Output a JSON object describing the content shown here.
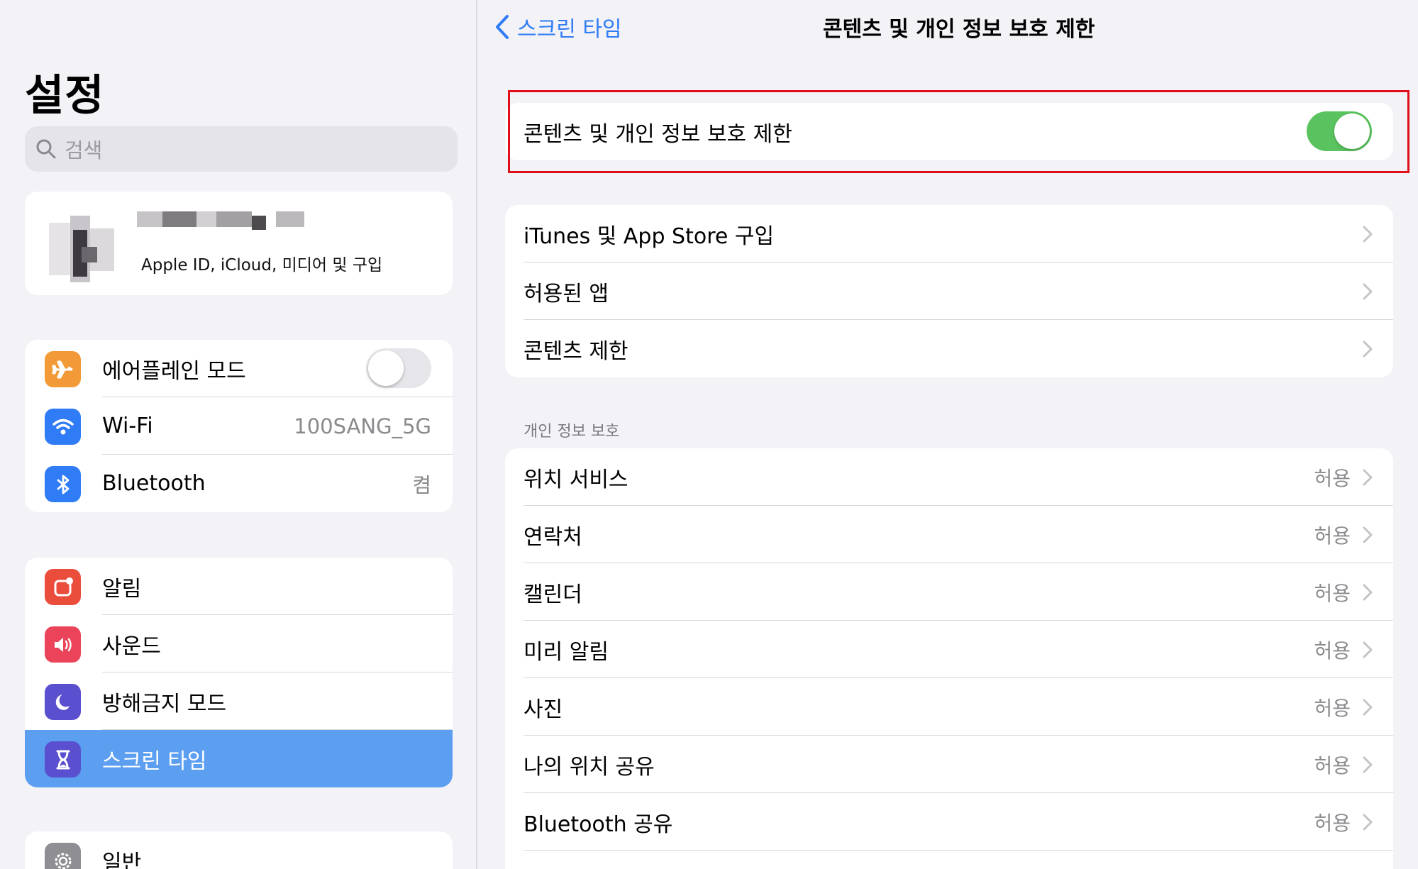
{
  "sidebar": {
    "title": "설정",
    "search_placeholder": "검색",
    "profile": {
      "subtitle": "Apple ID, iCloud, 미디어 및 구입"
    },
    "connectivity": [
      {
        "label": "에어플레인 모드",
        "icon": "airplane-icon",
        "color": "#f29a38",
        "toggle": false
      },
      {
        "label": "Wi-Fi",
        "icon": "wifi-icon",
        "color": "#2f7cf6",
        "value": "100SANG_5G"
      },
      {
        "label": "Bluetooth",
        "icon": "bluetooth-icon",
        "color": "#2f7cf6",
        "value": "켬"
      }
    ],
    "notifications": [
      {
        "label": "알림",
        "icon": "notifications-icon",
        "color": "#eb4d3d"
      },
      {
        "label": "사운드",
        "icon": "sound-icon",
        "color": "#eb445a"
      },
      {
        "label": "방해금지 모드",
        "icon": "moon-icon",
        "color": "#5a4fcf"
      },
      {
        "label": "스크린 타임",
        "icon": "hourglass-icon",
        "color": "#5a4fcf",
        "selected": true
      }
    ],
    "general": [
      {
        "label": "일반",
        "icon": "gear-icon",
        "color": "#8e8e93"
      }
    ]
  },
  "detail": {
    "back_label": "스크린 타임",
    "title": "콘텐츠 및 개인 정보 보호 제한",
    "main_toggle": {
      "label": "콘텐츠 및 개인 정보 보호 제한",
      "on": true,
      "highlight_color": "#e00f1a",
      "toggle_color": "#5ac35f"
    },
    "store_group": [
      {
        "label": "iTunes 및 App Store 구입"
      },
      {
        "label": "허용된 앱"
      },
      {
        "label": "콘텐츠 제한"
      }
    ],
    "privacy_header": "개인 정보 보호",
    "privacy_group": [
      {
        "label": "위치 서비스",
        "value": "허용"
      },
      {
        "label": "연락처",
        "value": "허용"
      },
      {
        "label": "캘린더",
        "value": "허용"
      },
      {
        "label": "미리 알림",
        "value": "허용"
      },
      {
        "label": "사진",
        "value": "허용"
      },
      {
        "label": "나의 위치 공유",
        "value": "허용"
      },
      {
        "label": "Bluetooth 공유",
        "value": "허용"
      }
    ]
  },
  "colors": {
    "accent": "#2f7cf6",
    "selected_row": "#5c9ef0",
    "background": "#f2f2f7"
  }
}
